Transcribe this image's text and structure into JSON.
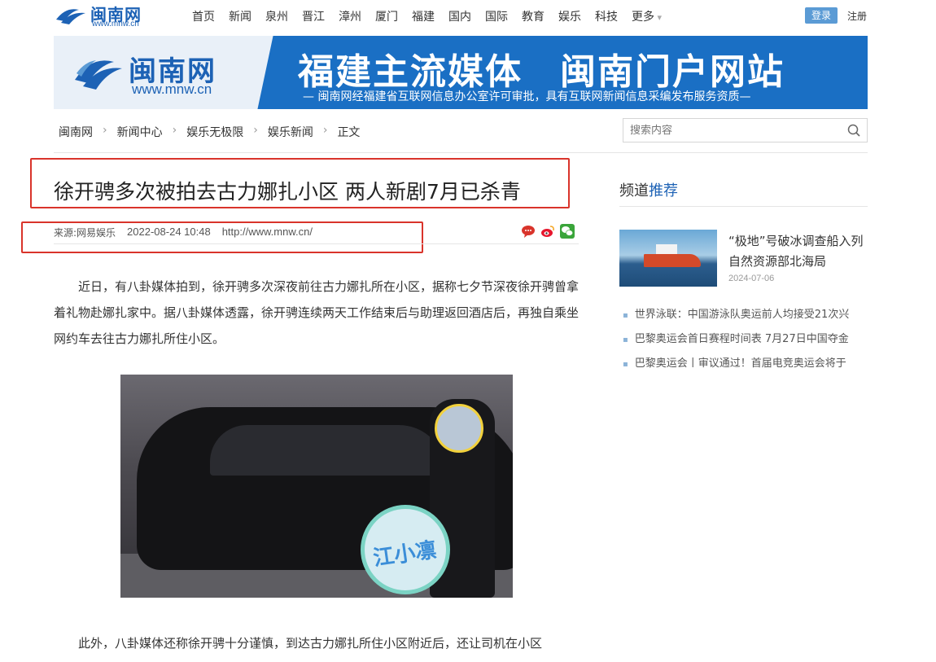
{
  "header": {
    "logo_cn": "闽南网",
    "logo_en": "www.mnw.cn",
    "nav": [
      "首页",
      "新闻",
      "泉州",
      "晋江",
      "漳州",
      "厦门",
      "福建",
      "国内",
      "国际",
      "教育",
      "娱乐",
      "科技",
      "更多"
    ],
    "login_label": "登录",
    "register_label": "注册"
  },
  "banner": {
    "logo_cn": "闽南网",
    "logo_en": "www.mnw.cn",
    "title": "福建主流媒体　闽南门户网站",
    "subtitle": "— 闽南网经福建省互联网信息办公室许可审批，具有互联网新闻信息采编发布服务资质—"
  },
  "breadcrumb": [
    "闽南网",
    "新闻中心",
    "娱乐无极限",
    "娱乐新闻",
    "正文"
  ],
  "search": {
    "placeholder": "搜索内容"
  },
  "article": {
    "title": "徐开骋多次被拍去古力娜扎小区 两人新剧7月已杀青",
    "source": "来源:网易娱乐",
    "date": "2022-08-24 10:48",
    "url": "http://www.mnw.cn/",
    "para1": "近日，有八卦媒体拍到，徐开骋多次深夜前往古力娜扎所在小区，据称七夕节深夜徐开骋曾拿着礼物赴娜扎家中。据八卦媒体透露，徐开骋连续两天工作结束后与助理返回酒店后，再独自乘坐网约车去往古力娜扎所住小区。",
    "photo_watermark": "江小凛",
    "para2": "此外，八卦媒体还称徐开骋十分谨慎，到达古力娜扎所住小区附近后，还让司机在小区"
  },
  "sidebar": {
    "head_part1": "频道",
    "head_part2": "推荐",
    "featured_title": "“极地”号破冰调查船入列自然资源部北海局",
    "featured_date": "2024-07-06",
    "list": [
      "世界泳联：中国游泳队奥运前人均接受21次兴",
      "巴黎奥运会首日赛程时间表 7月27日中国夺金",
      "巴黎奥运会丨审议通过！首届电竞奥运会将于"
    ]
  },
  "colors": {
    "brand_blue": "#1d62b5",
    "highlight_red": "#d9342b"
  }
}
